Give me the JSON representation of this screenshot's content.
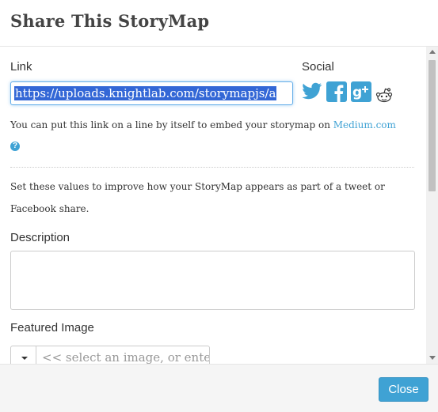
{
  "dialog": {
    "title": "Share This StoryMap"
  },
  "link_section": {
    "label": "Link",
    "url_value": "https://uploads.knightlab.com/storymapjs/a",
    "embed_note_prefix": "You can put this link on a line by itself to embed your storymap on ",
    "embed_note_link": "Medium.com"
  },
  "social": {
    "label": "Social",
    "icons": [
      "twitter-icon",
      "facebook-icon",
      "google-plus-icon",
      "reddit-icon"
    ],
    "colors": {
      "twitter": "#3fa2d4",
      "facebook": "#3fa2d4",
      "google_plus": "#3fa2d4"
    }
  },
  "help": {
    "icon": "question-circle-icon",
    "glyph": "?"
  },
  "share_settings": {
    "intro_line1": "Set these values to improve how your StoryMap appears as part of a tweet or",
    "intro_line2": "Facebook share.",
    "description_label": "Description",
    "description_value": "",
    "featured_image_label": "Featured Image",
    "featured_image_placeholder": "<< select an image, or ente"
  },
  "footer": {
    "close_label": "Close"
  },
  "theme": {
    "accent": "#3fa2d4",
    "selection": "#3367d6"
  }
}
